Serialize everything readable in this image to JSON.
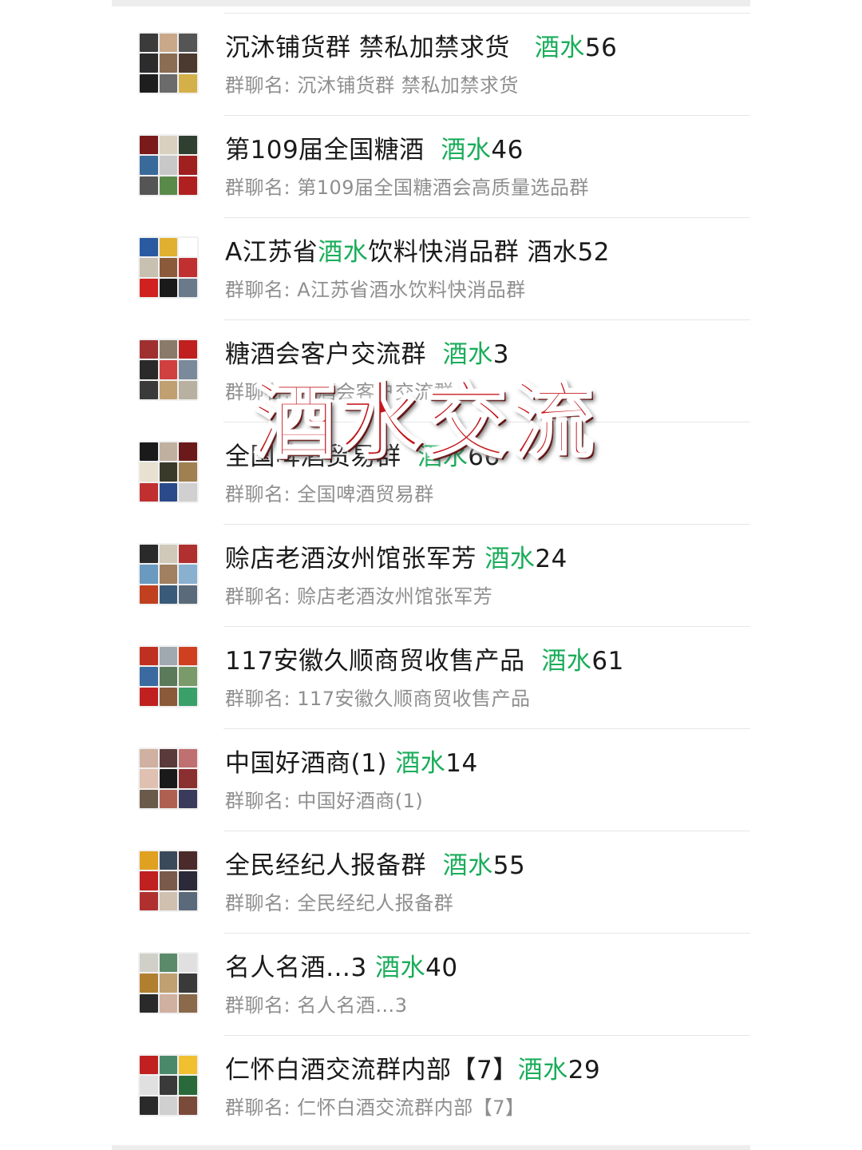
{
  "groups": [
    {
      "title": "沉沐铺货群 禁私加禁求货",
      "keyword": "酒水",
      "count": "56",
      "subtitle": "群聊名: 沉沐铺货群 禁私加禁求货",
      "gap": "   ",
      "avatar_colors": [
        "#3b3b3b",
        "#c9a88a",
        "#555555",
        "#2c2c2c",
        "#8a6d52",
        "#4a3a30",
        "#1e1e1e",
        "#6b6b6b",
        "#d4b04a"
      ]
    },
    {
      "title": "第109届全国糖酒",
      "keyword": "酒水",
      "count": "46",
      "subtitle": "群聊名: 第109届全国糖酒会高质量选品群",
      "gap": "  ",
      "avatar_colors": [
        "#7a1a1a",
        "#d9d0c0",
        "#2f4030",
        "#3a6a9a",
        "#c8c8c8",
        "#a02020",
        "#555555",
        "#5a8a4a",
        "#b02020"
      ]
    },
    {
      "title": "A江苏省",
      "keyword": "酒水",
      "count": "",
      "after": "饮料快消品群 酒水52",
      "subtitle": "群聊名: A江苏省酒水饮料快消品群",
      "gap": "",
      "avatar_colors": [
        "#2a5aa0",
        "#e0b030",
        "#ffffff",
        "#c8c0b0",
        "#8a5a3a",
        "#c03030",
        "#d02020",
        "#1a1a1a",
        "#6a7a8a"
      ]
    },
    {
      "title": "糖酒会客户交流群",
      "keyword": "酒水",
      "count": "3",
      "subtitle": "群聊名: 糖酒会客户交流群",
      "gap": "  ",
      "avatar_colors": [
        "#a03030",
        "#8a7a6a",
        "#c02020",
        "#2a2a2a",
        "#d04040",
        "#7a8a9a",
        "#3a3a3a",
        "#c0a070",
        "#b8b0a0"
      ]
    },
    {
      "title": "全国啤酒贸易群",
      "keyword": "酒水",
      "count": "66",
      "subtitle": "群聊名: 全国啤酒贸易群",
      "gap": "  ",
      "avatar_colors": [
        "#1a1a1a",
        "#c0b0a0",
        "#6a1a1a",
        "#e8e0d0",
        "#3a3a2a",
        "#a08050",
        "#c03030",
        "#2a4a8a",
        "#d0d0d0"
      ]
    },
    {
      "title": "赊店老酒汝州馆张军芳",
      "keyword": "酒水",
      "count": "24",
      "subtitle": "群聊名: 赊店老酒汝州馆张军芳",
      "gap": " ",
      "avatar_colors": [
        "#2a2a2a",
        "#d0c8b8",
        "#b03030",
        "#6a9ac0",
        "#a08060",
        "#8ab0d0",
        "#c04020",
        "#3a5a7a",
        "#5a6a7a"
      ]
    },
    {
      "title": "117安徽久顺商贸收售产品",
      "keyword": "酒水",
      "count": "61",
      "subtitle": "群聊名: 117安徽久顺商贸收售产品",
      "gap": "  ",
      "avatar_colors": [
        "#c03020",
        "#a0a8b0",
        "#d04020",
        "#3a6aa0",
        "#5a7a5a",
        "#7a9a6a",
        "#c02020",
        "#8a5a3a",
        "#3aa06a"
      ]
    },
    {
      "title": "中国好酒商(1)",
      "keyword": "酒水",
      "count": "14",
      "subtitle": "群聊名: 中国好酒商(1)",
      "gap": " ",
      "avatar_colors": [
        "#d0b0a0",
        "#5a3a3a",
        "#c07070",
        "#e0c0b0",
        "#1a1a1a",
        "#8a3030",
        "#6a5a4a",
        "#b06050",
        "#3a3a5a"
      ]
    },
    {
      "title": "全民经纪人报备群",
      "keyword": "酒水",
      "count": "55",
      "subtitle": "群聊名: 全民经纪人报备群",
      "gap": "  ",
      "avatar_colors": [
        "#e0a020",
        "#3a4a5a",
        "#4a2a2a",
        "#c02020",
        "#7a5a4a",
        "#2a2a3a",
        "#b03030",
        "#d0c0b0",
        "#5a6a7a"
      ]
    },
    {
      "title": "名人名酒…3",
      "keyword": "酒水",
      "count": "40",
      "subtitle": "群聊名: 名人名酒…3",
      "gap": " ",
      "avatar_colors": [
        "#d0d0c8",
        "#5a8a6a",
        "#e0e0e0",
        "#b08030",
        "#c0a070",
        "#3a3a3a",
        "#2a2a2a",
        "#d0b0a0",
        "#8a6a4a"
      ]
    },
    {
      "title": "仁怀白酒交流群内部【7】",
      "keyword": "酒水",
      "count": "29",
      "subtitle": "群聊名: 仁怀白酒交流群内部【7】",
      "gap": "",
      "avatar_colors": [
        "#c02020",
        "#4a8a6a",
        "#f0c030",
        "#e0e0e0",
        "#3a3a3a",
        "#2a6a3a",
        "#2a2a2a",
        "#d0d0d0",
        "#7a4a3a"
      ]
    }
  ],
  "overlay_text": "酒水交流"
}
